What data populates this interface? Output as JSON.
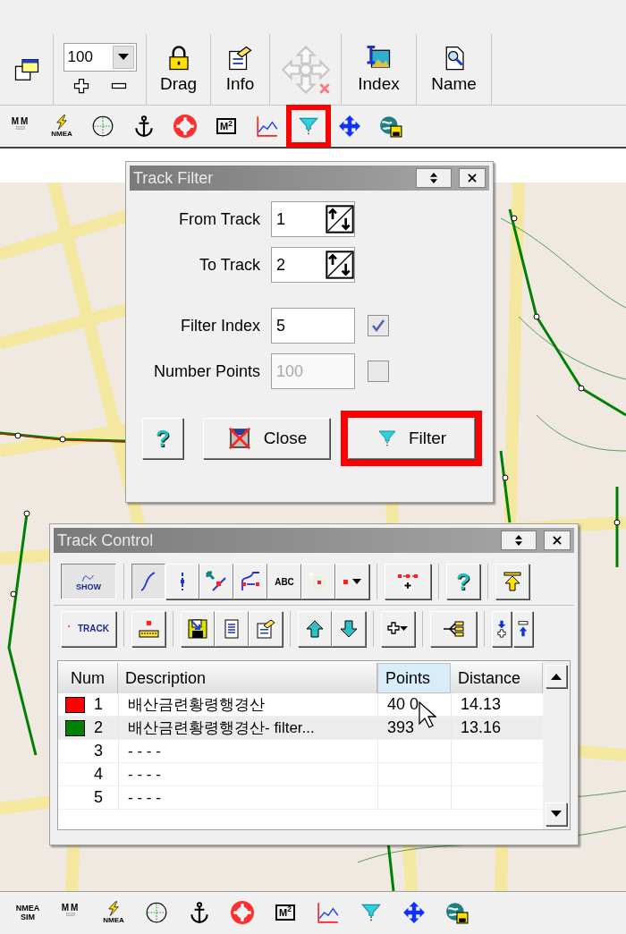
{
  "toolbar": {
    "zoom": {
      "value": "100"
    },
    "buttons": [
      {
        "kind": "lock",
        "label": "Drag",
        "disabled": false
      },
      {
        "kind": "info",
        "label": "Info",
        "disabled": false
      },
      {
        "kind": "pan",
        "disabled": true
      },
      {
        "kind": "index",
        "label": "Index",
        "disabled": false
      },
      {
        "kind": "name",
        "label": "Name",
        "disabled": false
      }
    ]
  },
  "icon_bar": [
    {
      "kind": "mm",
      "label": "MM",
      "highlighted": false
    },
    {
      "kind": "nmea",
      "label": "NMEA",
      "highlighted": false
    },
    {
      "kind": "grid",
      "highlighted": false
    },
    {
      "kind": "anchor",
      "highlighted": false
    },
    {
      "kind": "lifebuoy",
      "highlighted": false
    },
    {
      "kind": "m2",
      "label": "M$^{2}$",
      "highlighted": false
    },
    {
      "kind": "chart",
      "highlighted": false
    },
    {
      "kind": "filter",
      "highlighted": true
    },
    {
      "kind": "move",
      "highlighted": false
    },
    {
      "kind": "globe",
      "highlighted": false
    }
  ],
  "track_filter": {
    "title": "Track Filter",
    "fields": [
      {
        "kind": "spin",
        "label": "From Track",
        "value": "1"
      },
      {
        "kind": "spin",
        "label": "To Track",
        "value": "2"
      },
      {
        "kind": "check",
        "label": "Filter Index",
        "value": "5",
        "checked": true,
        "disabled": false
      },
      {
        "kind": "check",
        "label": "Number Points",
        "value": "100",
        "checked": false,
        "disabled": true
      }
    ],
    "buttons": [
      {
        "kind": "help",
        "label": "?",
        "highlighted": false
      },
      {
        "kind": "close",
        "label": "Close",
        "highlighted": false
      },
      {
        "kind": "filter",
        "label": "Filter",
        "highlighted": true
      }
    ]
  },
  "track_control": {
    "title": "Track Control",
    "toolbar_rows": [
      [
        [
          {
            "kind": "show",
            "label": "SHOW",
            "selected": true
          }
        ],
        [
          {
            "kind": "line",
            "selected": true
          },
          {
            "kind": "vpoint",
            "selected": false
          },
          {
            "kind": "movepoint",
            "selected": false
          },
          {
            "kind": "insertpoint",
            "selected": false
          },
          {
            "kind": "abc",
            "label": "ABC",
            "selected": false
          },
          {
            "kind": "starpoint",
            "selected": false
          },
          {
            "kind": "dotdrop",
            "selected": false
          }
        ],
        [
          {
            "kind": "addpoints",
            "selected": false
          }
        ],
        [
          {
            "kind": "help",
            "label": "?",
            "selected": false
          }
        ],
        [
          {
            "kind": "top",
            "selected": false
          }
        ]
      ],
      [
        [
          {
            "kind": "track",
            "label": "TRACK",
            "selected": false
          }
        ],
        [
          {
            "kind": "ruler",
            "selected": false
          }
        ],
        [
          {
            "kind": "save",
            "selected": false
          },
          {
            "kind": "list",
            "selected": false
          },
          {
            "kind": "info",
            "selected": false
          }
        ],
        [
          {
            "kind": "up",
            "selected": false
          },
          {
            "kind": "down",
            "selected": false
          }
        ],
        [
          {
            "kind": "plusdrop",
            "selected": false
          }
        ],
        [
          {
            "kind": "tree",
            "selected": false
          }
        ],
        [
          {
            "kind": "plusdown",
            "selected": false
          },
          {
            "kind": "minusup",
            "selected": false
          }
        ]
      ]
    ],
    "table": {
      "columns": [
        {
          "label": "Num",
          "hovered": false
        },
        {
          "label": "Description",
          "hovered": false
        },
        {
          "label": "Points",
          "hovered": true
        },
        {
          "label": "Distance",
          "hovered": false
        }
      ],
      "rows": [
        {
          "color": "#ff0000",
          "num": "1",
          "description": "배산금련황령행경산",
          "points": "40 0",
          "distance": "14.13",
          "selected": false
        },
        {
          "color": "#008000",
          "num": "2",
          "description": "배산금련황령행경산- filter...",
          "points": "393",
          "distance": "13.16",
          "selected": true
        },
        {
          "num": "3",
          "description": "- - - -",
          "selected": false
        },
        {
          "num": "4",
          "description": "- - - -",
          "selected": false
        },
        {
          "num": "5",
          "description": "- - - -",
          "selected": false
        }
      ]
    }
  },
  "bottom_bar": [
    {
      "kind": "nmeasim",
      "label": "NMEA SIM"
    },
    {
      "kind": "mm",
      "label": "MM"
    },
    {
      "kind": "nmea",
      "label": "NMEA"
    },
    {
      "kind": "grid"
    },
    {
      "kind": "anchor"
    },
    {
      "kind": "lifebuoy"
    },
    {
      "kind": "m2",
      "label": "M$^{2}$"
    },
    {
      "kind": "chart"
    },
    {
      "kind": "filter"
    },
    {
      "kind": "move"
    },
    {
      "kind": "globe"
    }
  ]
}
